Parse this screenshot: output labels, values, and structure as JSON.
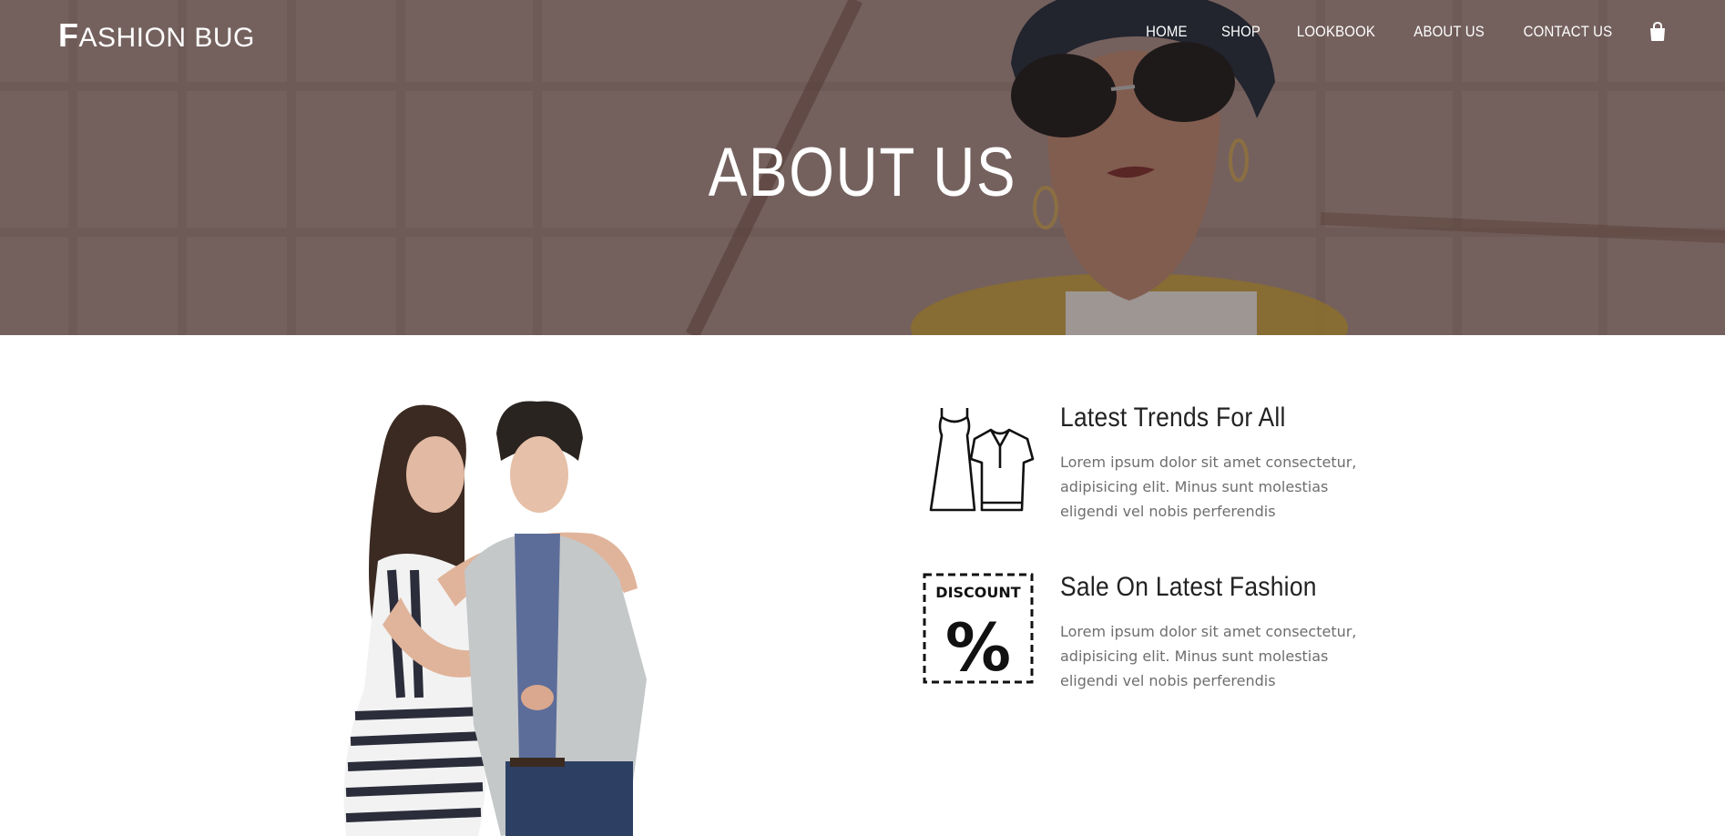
{
  "brand": {
    "first_letter": "F",
    "rest": "ASHION BUG"
  },
  "nav": {
    "items": [
      "HOME",
      "SHOP",
      "LOOKBOOK",
      "ABOUT US",
      "CONTACT US"
    ],
    "cart_icon": "shopping-bag-icon"
  },
  "hero": {
    "title": "ABOUT US"
  },
  "features": [
    {
      "icon": "dress-and-shirt-icon",
      "title": "Latest Trends For All",
      "description": "Lorem ipsum dolor sit amet consectetur, adipisicing elit. Minus sunt molestias eligendi vel nobis perferendis"
    },
    {
      "icon": "discount-tag-icon",
      "icon_text": "DISCOUNT",
      "icon_symbol": "%",
      "title": "Sale On Latest Fashion",
      "description": "Lorem ipsum dolor sit amet consectetur, adipisicing elit. Minus sunt molestias eligendi vel nobis perferendis"
    }
  ],
  "colors": {
    "hero_overlay": "#4a3533",
    "text_dark": "#222222",
    "text_muted": "#6e6e6e",
    "white": "#ffffff"
  }
}
